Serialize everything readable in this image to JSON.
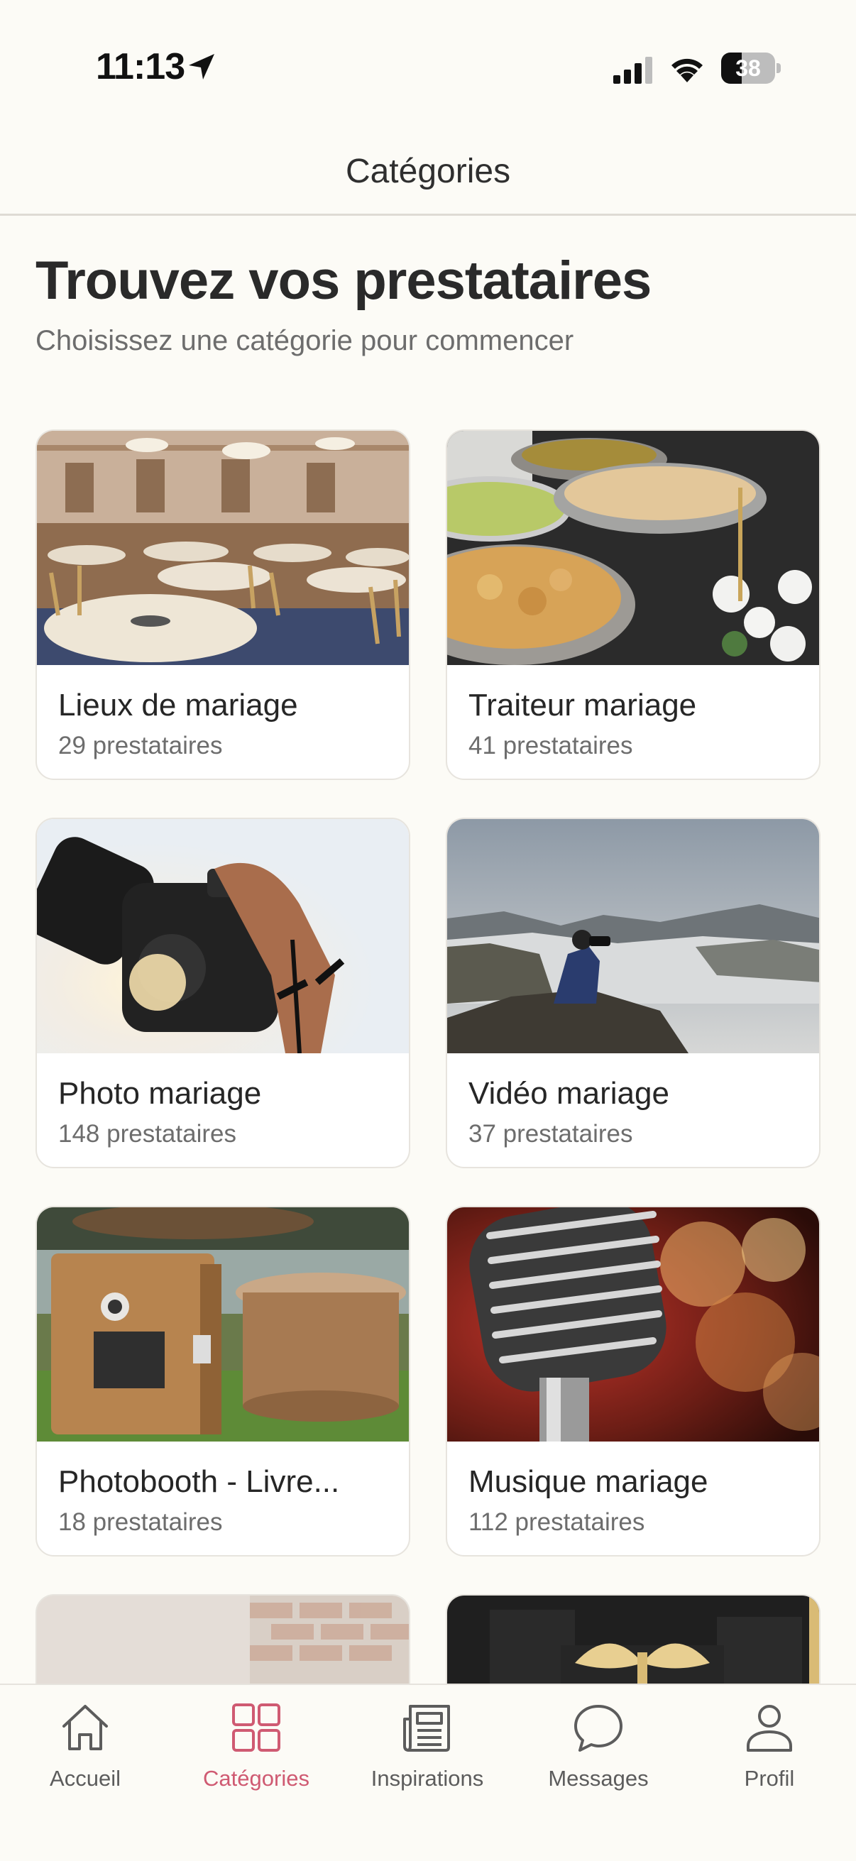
{
  "status_bar": {
    "time": "11:13",
    "battery_level": "38"
  },
  "header": {
    "title": "Catégories"
  },
  "intro": {
    "headline": "Trouvez vos prestataires",
    "subheadline": "Choisissez une catégorie pour commencer"
  },
  "categories": [
    {
      "title": "Lieux de mariage",
      "count": "29 prestataires"
    },
    {
      "title": "Traiteur mariage",
      "count": "41 prestataires"
    },
    {
      "title": "Photo mariage",
      "count": "148 prestataires"
    },
    {
      "title": "Vidéo mariage",
      "count": "37 prestataires"
    },
    {
      "title": "Photobooth - Livre...",
      "count": "18 prestataires"
    },
    {
      "title": "Musique mariage",
      "count": "112 prestataires"
    }
  ],
  "tab_bar": {
    "items": [
      {
        "label": "Accueil",
        "icon": "home-icon"
      },
      {
        "label": "Catégories",
        "icon": "grid-icon",
        "active": true
      },
      {
        "label": "Inspirations",
        "icon": "newspaper-icon"
      },
      {
        "label": "Messages",
        "icon": "chat-bubble-icon"
      },
      {
        "label": "Profil",
        "icon": "person-icon"
      }
    ]
  },
  "colors": {
    "accent": "#cf5a72",
    "background": "#fcfbf6",
    "card_border": "#e7e4de"
  }
}
